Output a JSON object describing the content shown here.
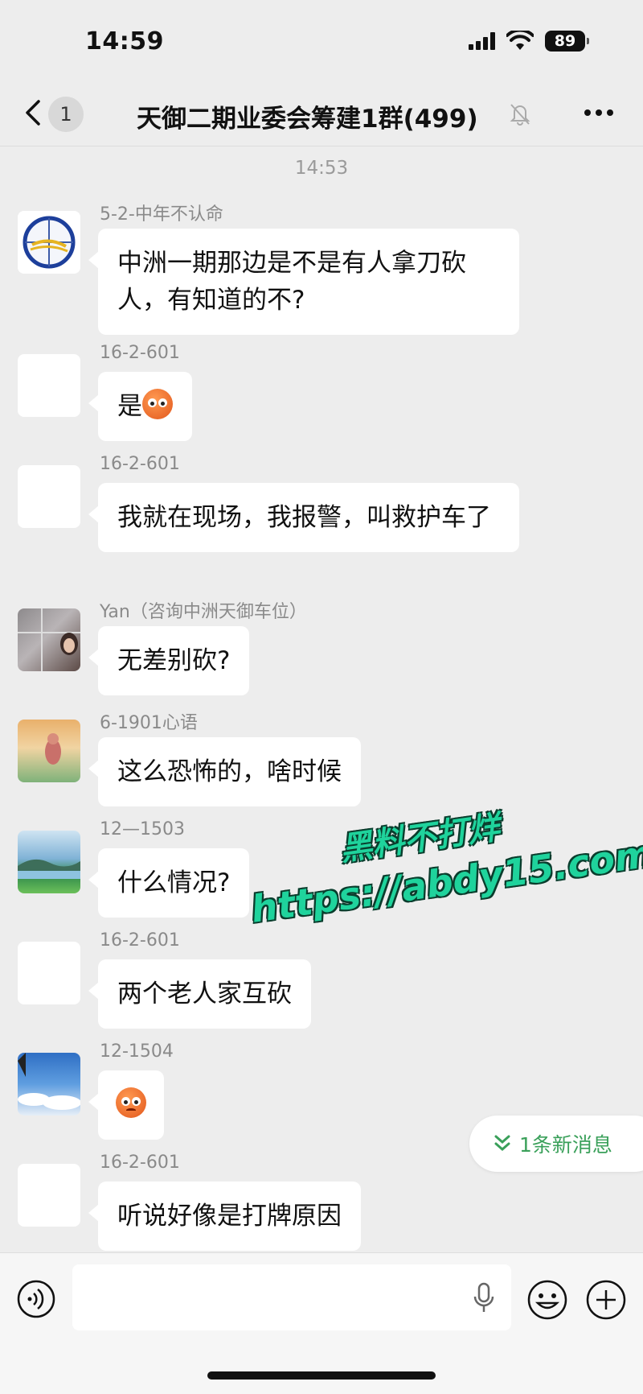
{
  "status_bar": {
    "time": "14:59",
    "battery": "89"
  },
  "header": {
    "back_badge": "1",
    "title": "天御二期业委会筹建1群(499)"
  },
  "timestamp": "14:53",
  "messages": [
    {
      "sender": "5-2-中年不认命",
      "text": "中洲一期那边是不是有人拿刀砍人，有知道的不?",
      "avatar": "logo"
    },
    {
      "sender": "16-2-601",
      "text": "是",
      "emoji": "shocked-face",
      "avatar": "blank"
    },
    {
      "sender": "16-2-601",
      "text": "我就在现场，我报警，叫救护车了",
      "avatar": "blank"
    },
    {
      "sender": "Yan（咨询中洲天御车位）",
      "text": "无差别砍?",
      "avatar": "photo-window"
    },
    {
      "sender": "6-1901心语",
      "text": "这么恐怖的，啥时候",
      "avatar": "photo-sunset"
    },
    {
      "sender": "12—1503",
      "text": "什么情况?",
      "avatar": "photo-lake"
    },
    {
      "sender": "16-2-601",
      "text": "两个老人家互砍",
      "avatar": "blank"
    },
    {
      "sender": "12-1504",
      "text": "",
      "emoji": "worried-face",
      "avatar": "photo-sky"
    },
    {
      "sender": "16-2-601",
      "text": "听说好像是打牌原因",
      "avatar": "blank"
    }
  ],
  "new_messages": "1条新消息",
  "watermark": {
    "line1": "黑料不打烊",
    "line2": "https://abdy15.com"
  },
  "input": {
    "value": "",
    "placeholder": ""
  },
  "colors": {
    "background": "#ededed",
    "bubble": "#ffffff",
    "accent_green": "#3aa05a",
    "watermark": "#1fd39c"
  }
}
